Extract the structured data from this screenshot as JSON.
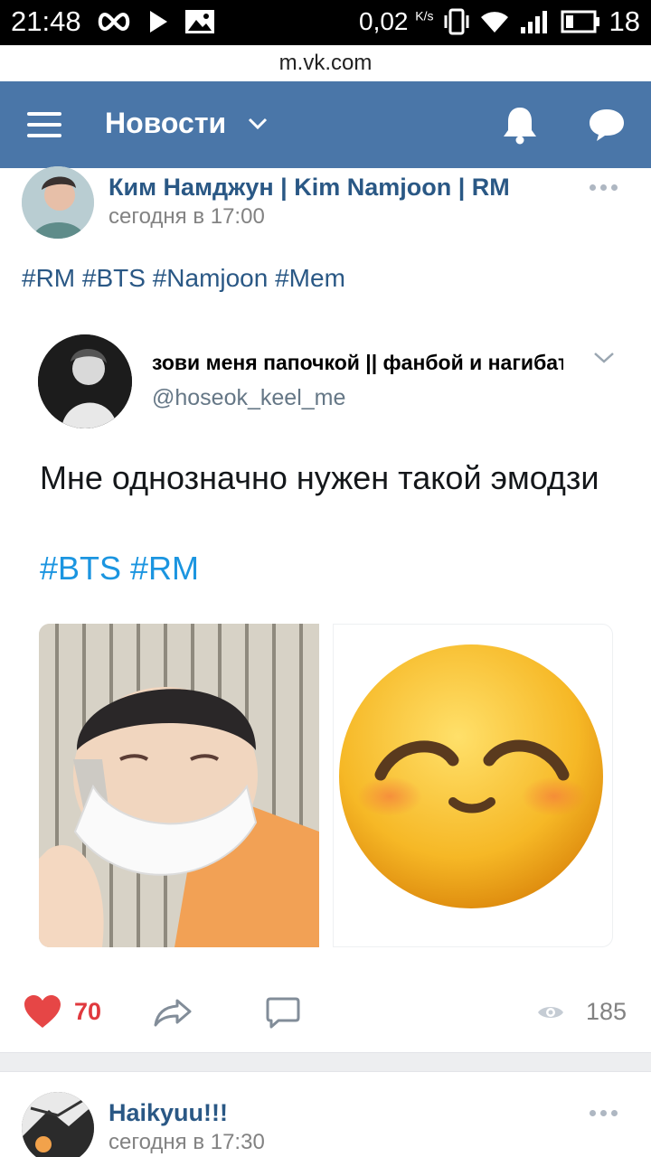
{
  "status_bar": {
    "time": "21:48",
    "speed": "0,02",
    "speed_unit": "K/s",
    "battery": "18",
    "icons": [
      "infinity-icon",
      "play-icon",
      "image-icon",
      "vibrate-icon",
      "wifi-icon",
      "signal-icon",
      "battery-icon"
    ]
  },
  "browser": {
    "url": "m.vk.com"
  },
  "header": {
    "title": "Новости",
    "icons": [
      "menu-icon",
      "chevron-down-icon",
      "bell-icon",
      "message-icon"
    ],
    "color": "#4a76a8"
  },
  "post": {
    "author": "Ким Намджун | Kim Namjoon | RM",
    "time": "сегодня в 17:00",
    "tags": "#RM #BTS #Namjoon #Mem",
    "tweet": {
      "name": "зови меня папочкой || фанбой и нагибатор",
      "handle": "@hoseok_keel_me",
      "text": "Мне однозначно нужен такой эмодзи",
      "tags": "#BTS #RM"
    },
    "likes": "70",
    "views": "185",
    "like_color": "#e64646"
  },
  "next_post": {
    "author": "Haikyuu!!!",
    "time": "сегодня в 17:30"
  }
}
